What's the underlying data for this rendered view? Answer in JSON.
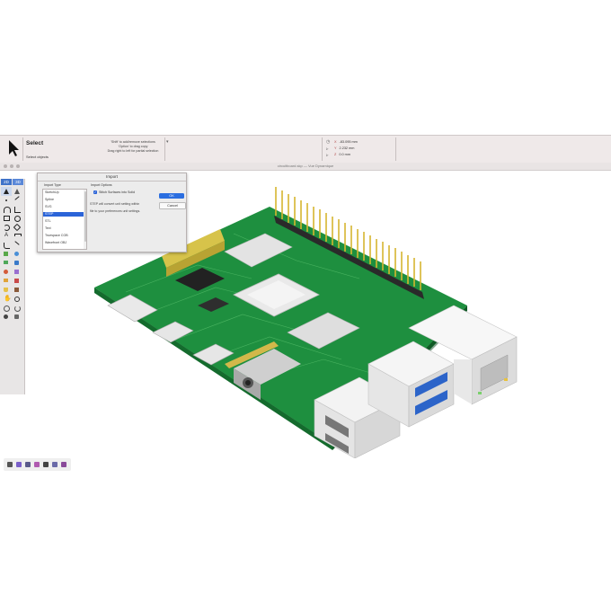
{
  "toolbar": {
    "tool_name": "Select",
    "status": "Select objects",
    "hints": [
      "'Shift' to add/remove selections",
      "'Option' to drag copy",
      "Drag right to left for partial selection"
    ],
    "coordinates": [
      {
        "axis": "X",
        "value": "-83.095 mm"
      },
      {
        "axis": "Y",
        "value": "2.232 mm"
      },
      {
        "axis": "Z",
        "value": "0.0 mm"
      }
    ]
  },
  "window": {
    "title": "circuitboard.skp — Vue Dynamique"
  },
  "palette": {
    "tab_2d": "2D",
    "tab_3d": "3D"
  },
  "import_dialog": {
    "title": "Import",
    "import_type_label": "Import Type",
    "import_options_label": "Import Options",
    "types": [
      "SketchUp",
      "Spline",
      "SVG",
      "STEP",
      "STL",
      "Text",
      "Truespace COB",
      "Wavefront OBJ"
    ],
    "selected_type": "STEP",
    "option_stitch": "Stitch Surfaces into Solid",
    "stitch_checked": true,
    "note_1": "STEP will convert unit setting within",
    "note_2": "file to your preferences unit settings.",
    "ok_label": "OK",
    "cancel_label": "Cancel"
  }
}
